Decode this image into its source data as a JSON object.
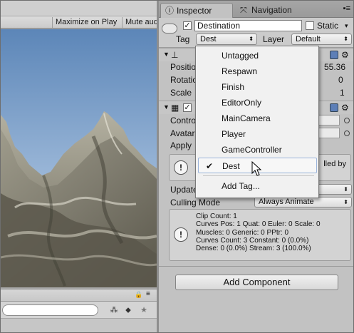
{
  "game_view": {
    "toolbar": {
      "maximize_on_play": "Maximize on Play",
      "mute_audio": "Mute aud"
    }
  },
  "project_panel": {
    "search_placeholder": ""
  },
  "inspector": {
    "tabs": [
      {
        "label": "Inspector",
        "icon": "info-icon",
        "active": true
      },
      {
        "label": "Navigation",
        "icon": "navigation-icon",
        "active": false
      }
    ],
    "gameobject": {
      "active": true,
      "name": "Destination",
      "static_label": "Static",
      "static_checked": false,
      "tag_label": "Tag",
      "tag_value": "Dest",
      "layer_label": "Layer",
      "layer_value": "Default"
    },
    "transform": {
      "position_label": "Positio",
      "position_value": "55.36",
      "rotation_label": "Rotatio",
      "rotation_value": "0",
      "scale_label": "Scale",
      "scale_value": "1"
    },
    "animator": {
      "enabled": true,
      "controller_label": "Contro",
      "avatar_label": "Avatar",
      "apply_label": "Apply",
      "info_text": "lled by",
      "update_label": "Update",
      "culling_label": "Culling Mode",
      "culling_value": "Always Animate",
      "stats": [
        "Clip Count: 1",
        "Curves Pos: 1 Quat: 0 Euler: 0 Scale: 0",
        "Muscles: 0 Generic: 0 PPtr: 0",
        "Curves Count: 3 Constant: 0 (0.0%)",
        "Dense: 0 (0.0%) Stream: 3 (100.0%)"
      ]
    },
    "add_component": "Add Component"
  },
  "tag_menu": {
    "items": [
      "Untagged",
      "Respawn",
      "Finish",
      "EditorOnly",
      "MainCamera",
      "Player",
      "GameController",
      "Dest"
    ],
    "selected": "Dest",
    "add_tag": "Add Tag..."
  },
  "colors": {
    "panel_bg": "#c2c2c2",
    "menu_bg": "#f1f1f1",
    "selection_border": "#9bb4da",
    "sky_top": "#5c86b8",
    "sky_bottom": "#c9dbef"
  }
}
